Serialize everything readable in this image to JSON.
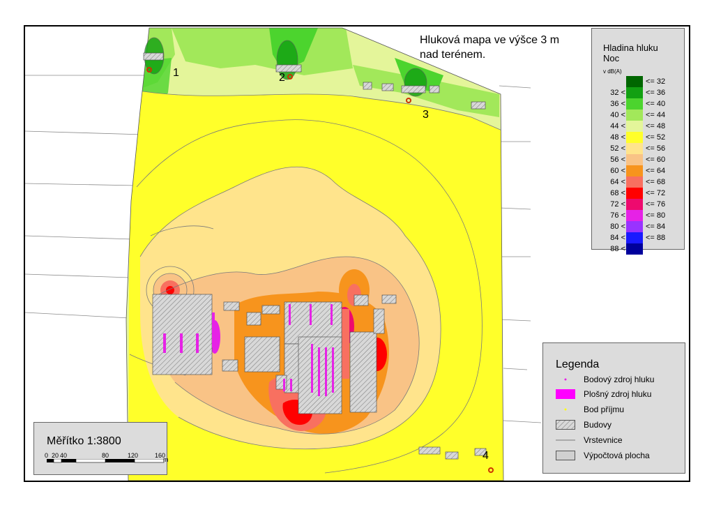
{
  "map": {
    "title_line1": "Hluková mapa ve výšce 3 m",
    "title_line2": "nad terénem.",
    "receivers": [
      {
        "label": "1",
        "marker_color": "#cc3300"
      },
      {
        "label": "2",
        "marker_color": "#cc3300"
      },
      {
        "label": "3",
        "marker_color": "#cc3300"
      },
      {
        "label": "4",
        "marker_color": "#cc3300"
      }
    ]
  },
  "noise_legend": {
    "title_line1": "Hladina hluku",
    "title_line2": "Noc",
    "unit": "v dB(A)",
    "classes": [
      {
        "low": "",
        "high": "<= 32",
        "color": "#006600"
      },
      {
        "low": "32 <",
        "high": "<= 36",
        "color": "#12a012"
      },
      {
        "low": "36 <",
        "high": "<= 40",
        "color": "#4cd42e"
      },
      {
        "low": "40 <",
        "high": "<= 44",
        "color": "#a2e85a"
      },
      {
        "low": "44 <",
        "high": "<= 48",
        "color": "#e4f59a"
      },
      {
        "low": "48 <",
        "high": "<= 52",
        "color": "#ffff2a"
      },
      {
        "low": "52 <",
        "high": "<= 56",
        "color": "#ffe48c"
      },
      {
        "low": "56 <",
        "high": "<= 60",
        "color": "#f9c386"
      },
      {
        "low": "60 <",
        "high": "<= 64",
        "color": "#f7941d"
      },
      {
        "low": "64 <",
        "high": "<= 68",
        "color": "#f87060"
      },
      {
        "low": "68 <",
        "high": "<= 72",
        "color": "#ff0000"
      },
      {
        "low": "72 <",
        "high": "<= 76",
        "color": "#ee0a6e"
      },
      {
        "low": "76 <",
        "high": "<= 80",
        "color": "#e622e6"
      },
      {
        "low": "80 <",
        "high": "<= 84",
        "color": "#9933ff"
      },
      {
        "low": "84 <",
        "high": "<= 88",
        "color": "#1a1aff"
      },
      {
        "low": "88 <",
        "high": "",
        "color": "#00009c"
      }
    ]
  },
  "legend": {
    "title": "Legenda",
    "items": [
      {
        "label": "Bodový zdroj hluku",
        "symbol": "point-source"
      },
      {
        "label": "Plošný zdroj hluku",
        "symbol": "area-source"
      },
      {
        "label": "Bod příjmu",
        "symbol": "receiver-point"
      },
      {
        "label": "Budovy",
        "symbol": "building-hatch"
      },
      {
        "label": "Vrstevnice",
        "symbol": "contour-line"
      },
      {
        "label": "Výpočtová plocha",
        "symbol": "calc-area"
      }
    ]
  },
  "scale": {
    "title": "Měřítko 1:3800",
    "ticks": [
      "0",
      "20",
      "40",
      "80",
      "120",
      "160"
    ],
    "unit": "m"
  }
}
